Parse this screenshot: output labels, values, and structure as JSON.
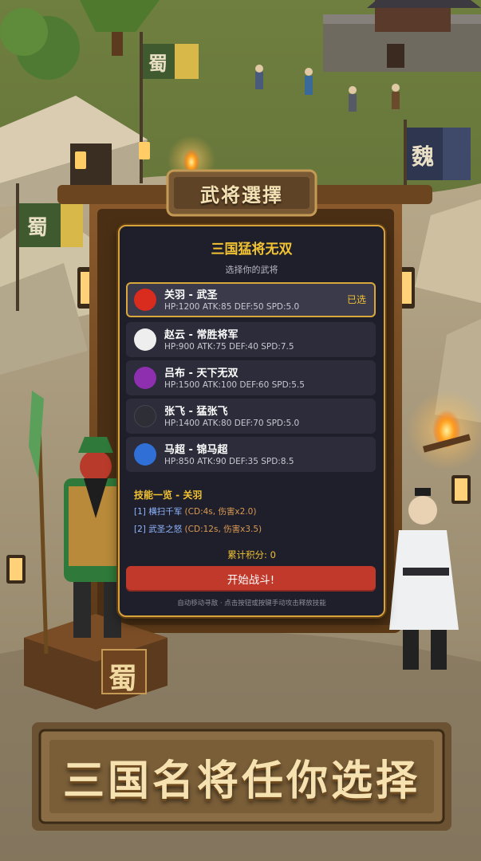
{
  "scene": {
    "flags": [
      "蜀",
      "蜀",
      "魏"
    ],
    "pedestal_sign": "蜀"
  },
  "banner": {
    "title": "武将選擇"
  },
  "panel": {
    "title": "三国猛将无双",
    "subtitle": "选择你的武将",
    "heroes": [
      {
        "name": "关羽 - 武圣",
        "stats": "HP:1200 ATK:85 DEF:50 SPD:5.0",
        "color": "#d92b1e",
        "badge": "已选",
        "selected": true
      },
      {
        "name": "赵云 - 常胜将军",
        "stats": "HP:900 ATK:75 DEF:40 SPD:7.5",
        "color": "#eeeeee",
        "badge": "",
        "selected": false
      },
      {
        "name": "吕布 - 天下无双",
        "stats": "HP:1500 ATK:100 DEF:60 SPD:5.5",
        "color": "#8e2fb0",
        "badge": "",
        "selected": false
      },
      {
        "name": "张飞 - 猛张飞",
        "stats": "HP:1400 ATK:80 DEF:70 SPD:5.0",
        "color": "#2e2e36",
        "badge": "",
        "selected": false
      },
      {
        "name": "马超 - 锦马超",
        "stats": "HP:850 ATK:90 DEF:35 SPD:8.5",
        "color": "#2f6fd6",
        "badge": "",
        "selected": false
      }
    ],
    "skills_title": "技能一览 - 关羽",
    "skills": [
      {
        "name": "[1] 横扫千军",
        "info": " (CD:4s, 伤害x2.0)"
      },
      {
        "name": "[2] 武圣之怒",
        "info": " (CD:12s, 伤害x3.5)"
      }
    ],
    "score": "累计积分: 0",
    "start_label": "开始战斗!",
    "hint": "自动移动寻敌 · 点击按钮或按键手动攻击释放技能"
  },
  "caption": "三国名将任你选择"
}
